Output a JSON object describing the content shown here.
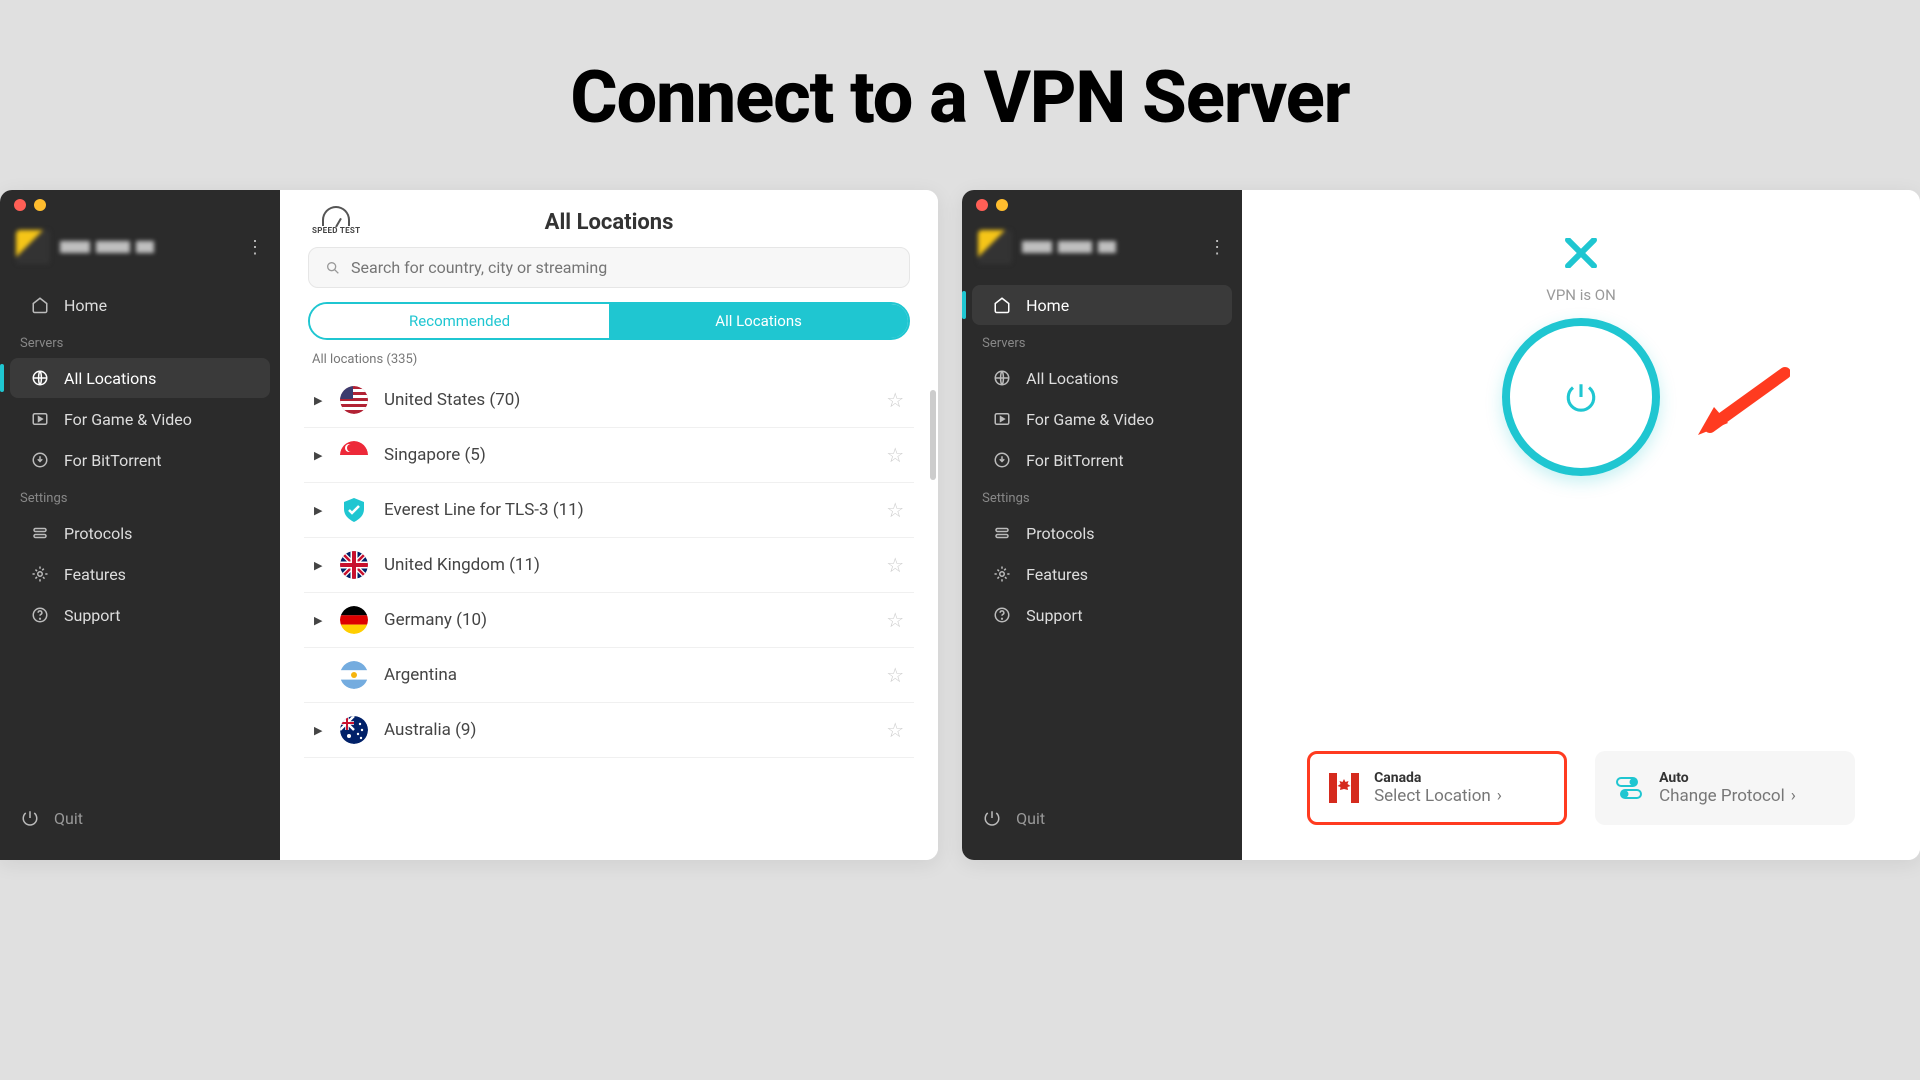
{
  "page_title": "Connect to a VPN Server",
  "sidebar": {
    "nav": [
      {
        "icon": "home",
        "label": "Home"
      }
    ],
    "servers_label": "Servers",
    "servers": [
      {
        "icon": "globe",
        "label": "All Locations"
      },
      {
        "icon": "play",
        "label": "For Game & Video"
      },
      {
        "icon": "download",
        "label": "For BitTorrent"
      }
    ],
    "settings_label": "Settings",
    "settings": [
      {
        "icon": "protocol",
        "label": "Protocols"
      },
      {
        "icon": "gear",
        "label": "Features"
      },
      {
        "icon": "help",
        "label": "Support"
      }
    ],
    "quit_label": "Quit"
  },
  "window1": {
    "active_nav": "All Locations",
    "speedtest_label": "SPEED TEST",
    "title": "All Locations",
    "search_placeholder": "Search for country, city or streaming",
    "tab_recommended": "Recommended",
    "tab_all": "All Locations",
    "list_header": "All locations (335)",
    "locations": [
      {
        "name": "United States (70)",
        "flag": "us",
        "expandable": true
      },
      {
        "name": "Singapore (5)",
        "flag": "sg",
        "expandable": true
      },
      {
        "name": "Everest Line for TLS-3 (11)",
        "flag": "shield",
        "expandable": true
      },
      {
        "name": "United Kingdom (11)",
        "flag": "uk",
        "expandable": true
      },
      {
        "name": "Germany (10)",
        "flag": "de",
        "expandable": true
      },
      {
        "name": "Argentina",
        "flag": "ar",
        "expandable": false
      },
      {
        "name": "Australia (9)",
        "flag": "au",
        "expandable": true
      }
    ]
  },
  "window2": {
    "active_nav": "Home",
    "vpn_status": "VPN is ON",
    "location_card": {
      "title": "Canada",
      "sub": "Select Location",
      "flag": "ca"
    },
    "protocol_card": {
      "title": "Auto",
      "sub": "Change Protocol"
    }
  }
}
